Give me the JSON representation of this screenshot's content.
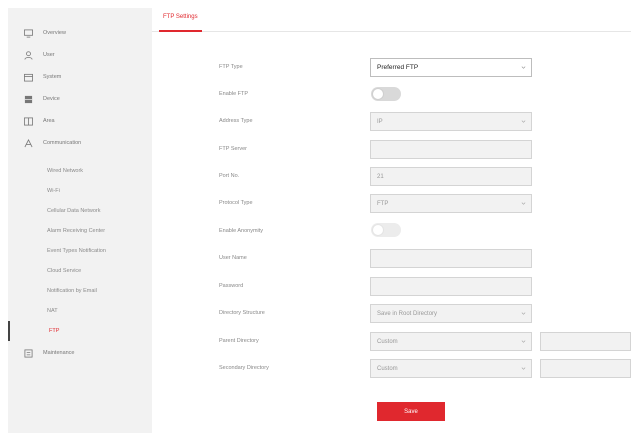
{
  "sidebar": {
    "items": [
      {
        "label": "Overview",
        "icon": "monitor-icon"
      },
      {
        "label": "User",
        "icon": "user-icon"
      },
      {
        "label": "System",
        "icon": "system-icon"
      },
      {
        "label": "Device",
        "icon": "device-icon"
      },
      {
        "label": "Area",
        "icon": "area-icon"
      },
      {
        "label": "Communication",
        "icon": "communication-icon"
      }
    ],
    "sub_items": [
      {
        "label": "Wired Network"
      },
      {
        "label": "Wi-Fi"
      },
      {
        "label": "Cellular Data Network"
      },
      {
        "label": "Alarm Receiving Center"
      },
      {
        "label": "Event Types Notification"
      },
      {
        "label": "Cloud Service"
      },
      {
        "label": "Notification by Email"
      },
      {
        "label": "NAT"
      },
      {
        "label": "FTP"
      }
    ],
    "maintenance": {
      "label": "Maintenance",
      "icon": "maintenance-icon"
    }
  },
  "tab": {
    "label": "FTP Settings"
  },
  "form": {
    "ftp_type": {
      "label": "FTP Type",
      "value": "Preferred FTP"
    },
    "enable_ftp": {
      "label": "Enable FTP"
    },
    "address_type": {
      "label": "Address Type",
      "value": "IP"
    },
    "ftp_server": {
      "label": "FTP Server",
      "value": ""
    },
    "port_no": {
      "label": "Port No.",
      "value": "21"
    },
    "protocol_type": {
      "label": "Protocol Type",
      "value": "FTP"
    },
    "enable_anonymity": {
      "label": "Enable Anonymity"
    },
    "user_name": {
      "label": "User Name",
      "value": ""
    },
    "password": {
      "label": "Password",
      "value": ""
    },
    "directory_structure": {
      "label": "Directory Structure",
      "value": "Save in Root Directory"
    },
    "parent_directory": {
      "label": "Parent Directory",
      "value": "Custom"
    },
    "secondary_directory": {
      "label": "Secondary Directory",
      "value": "Custom"
    }
  },
  "save_label": "Save",
  "colors": {
    "accent": "#e0282e",
    "sidebar_bg": "#f2f2f2",
    "field_bg": "#f2f2f2"
  }
}
